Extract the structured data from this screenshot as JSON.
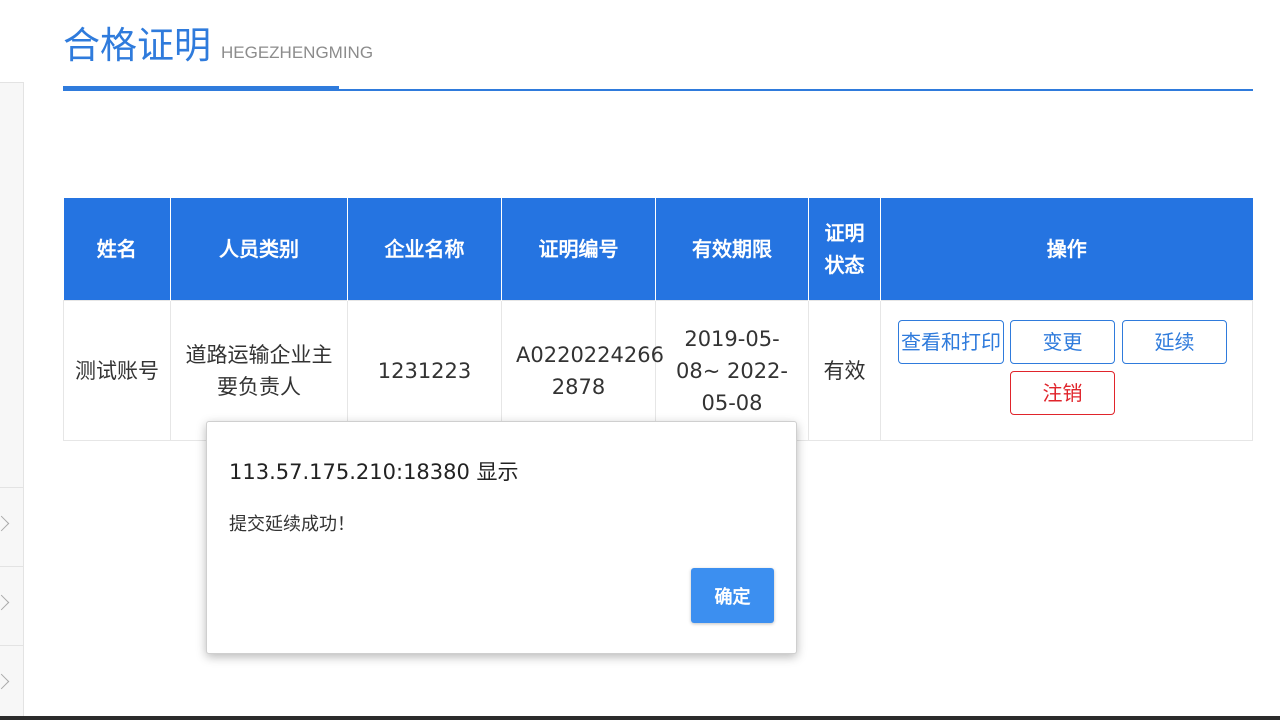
{
  "page": {
    "title": "合格证明",
    "subtitle": "HEGEZHENGMING"
  },
  "table": {
    "headers": [
      "姓名",
      "人员类别",
      "企业名称",
      "证明编号",
      "有效期限",
      "证明\n状态",
      "操作"
    ],
    "rows": [
      {
        "name": "测试账号",
        "category": "道路运输企业主要负责人",
        "company": "1231223",
        "cert_no": "A0220224266 2878",
        "validity": "2019-05-08~ 2022-05-08",
        "status": "有效",
        "actions": {
          "view_print": "查看和打印",
          "change": "变更",
          "renew": "延续",
          "cancel": "注销"
        }
      }
    ]
  },
  "dialog": {
    "origin": "113.57.175.210:18380 显示",
    "message": "提交延续成功！",
    "ok_label": "确定"
  },
  "colors": {
    "accent": "#2f7bdc",
    "header_bg": "#2574e1",
    "danger": "#e0242b",
    "dialog_button": "#3c8ff0"
  }
}
